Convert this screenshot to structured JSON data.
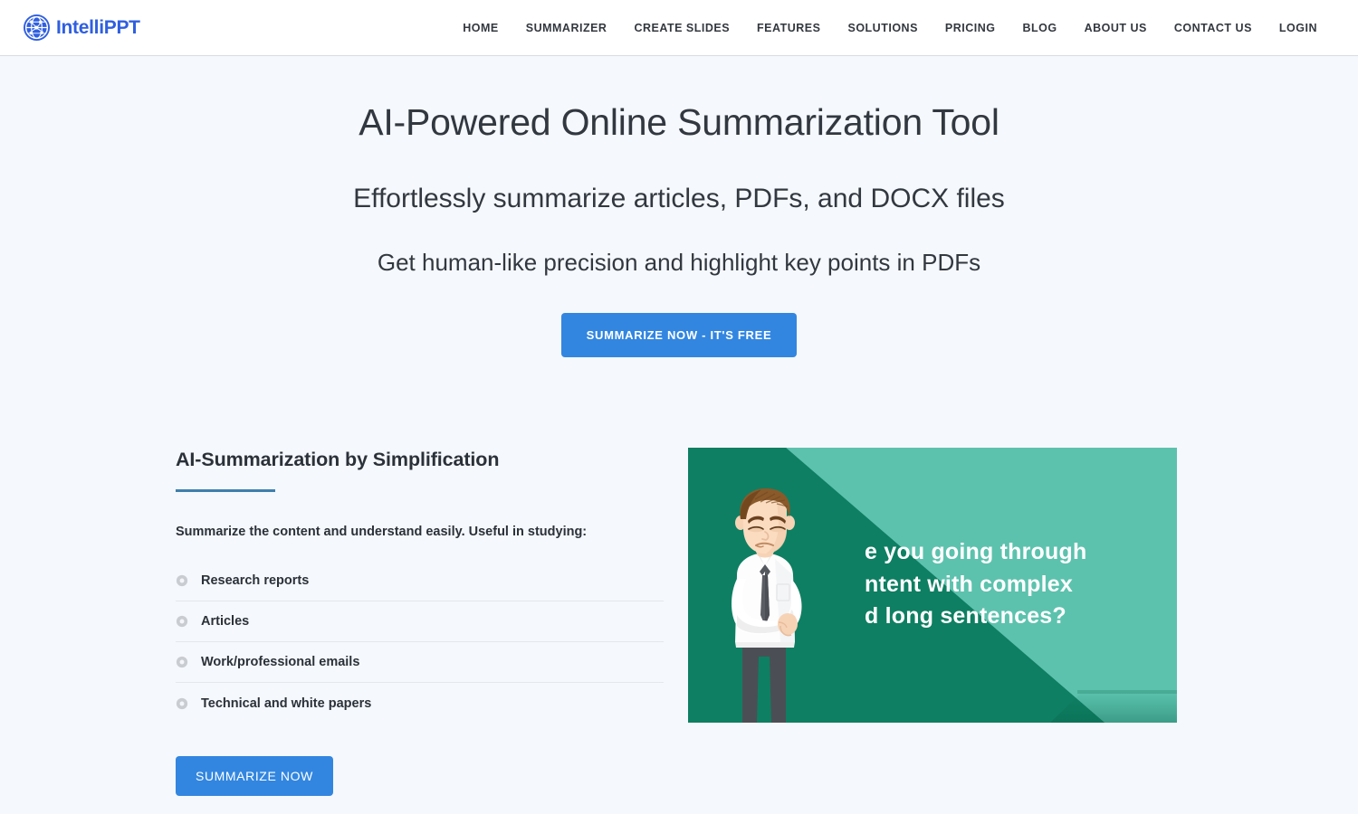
{
  "brand": {
    "name": "IntelliPPT",
    "logo_icon": "globe-network-icon",
    "color": "#2f5fe0"
  },
  "nav": {
    "items": [
      {
        "label": "HOME",
        "name": "home"
      },
      {
        "label": "SUMMARIZER",
        "name": "summarizer"
      },
      {
        "label": "CREATE SLIDES",
        "name": "create-slides"
      },
      {
        "label": "FEATURES",
        "name": "features"
      },
      {
        "label": "SOLUTIONS",
        "name": "solutions"
      },
      {
        "label": "PRICING",
        "name": "pricing"
      },
      {
        "label": "BLOG",
        "name": "blog"
      },
      {
        "label": "ABOUT US",
        "name": "about-us"
      },
      {
        "label": "CONTACT US",
        "name": "contact-us"
      },
      {
        "label": "LOGIN",
        "name": "login"
      }
    ]
  },
  "hero": {
    "title": "AI-Powered Online Summarization Tool",
    "subtitle_1": "Effortlessly summarize articles, PDFs, and DOCX files",
    "subtitle_2": "Get human-like precision and highlight key points in PDFs",
    "cta_label": "SUMMARIZE NOW - IT'S FREE",
    "cta_color": "#3286e0"
  },
  "feature": {
    "heading": "AI-Summarization by Simplification",
    "underline_color": "#3d7fad",
    "lead": "Summarize the content and understand easily. Useful in studying:",
    "items": [
      {
        "label": "Research reports",
        "icon": "circle-bullet-icon"
      },
      {
        "label": "Articles",
        "icon": "circle-bullet-icon"
      },
      {
        "label": "Work/professional emails",
        "icon": "circle-bullet-icon"
      },
      {
        "label": "Technical and white papers",
        "icon": "circle-bullet-icon"
      }
    ],
    "cta_label": "SUMMARIZE NOW",
    "media": {
      "caption_line_1": "e you going through",
      "caption_line_2": "ntent with complex",
      "caption_line_3": "d long sentences?",
      "background_color": "#0f7d62",
      "accent_color": "#5cc2ad",
      "alt": "cartoon businessman thinking"
    }
  }
}
